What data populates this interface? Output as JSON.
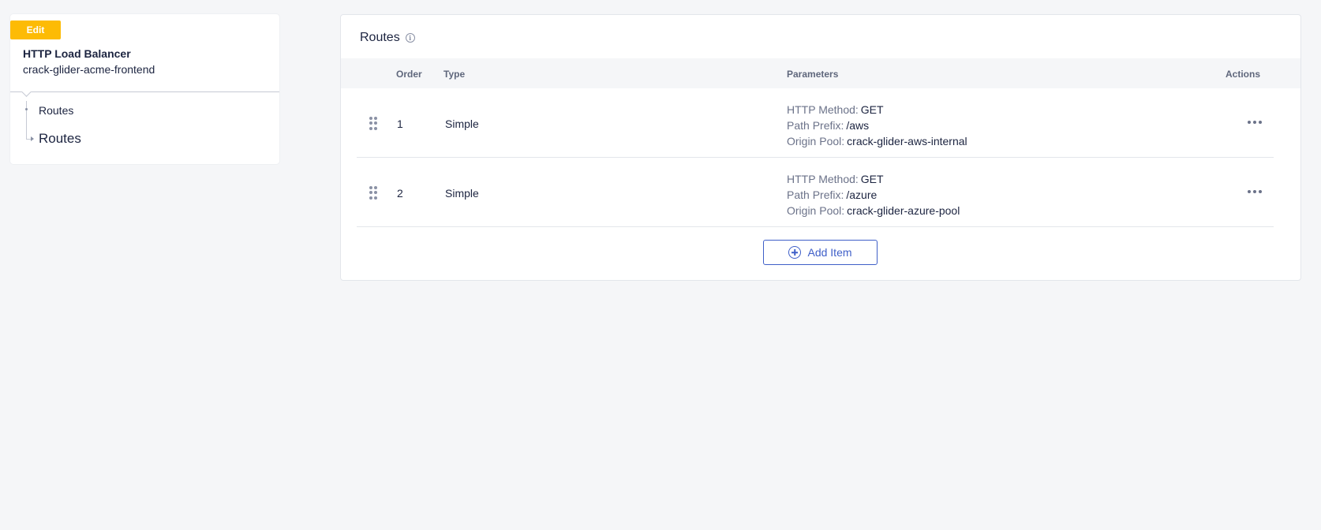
{
  "sidebar": {
    "badge": "Edit",
    "object_type": "HTTP Load Balancer",
    "object_name": "crack-glider-acme-frontend",
    "tree": [
      {
        "label": "Routes"
      },
      {
        "label": "Routes"
      }
    ]
  },
  "routes_card": {
    "title": "Routes",
    "info_icon": "info-icon",
    "columns": {
      "order": "Order",
      "type": "Type",
      "parameters": "Parameters",
      "actions": "Actions"
    },
    "rows": [
      {
        "order": "1",
        "type": "Simple",
        "params": [
          {
            "key": "HTTP Method:",
            "value": "GET"
          },
          {
            "key": "Path Prefix:",
            "value": "/aws"
          },
          {
            "key": "Origin Pool:",
            "value": "crack-glider-aws-internal"
          }
        ]
      },
      {
        "order": "2",
        "type": "Simple",
        "params": [
          {
            "key": "HTTP Method:",
            "value": "GET"
          },
          {
            "key": "Path Prefix:",
            "value": "/azure"
          },
          {
            "key": "Origin Pool:",
            "value": "crack-glider-azure-pool"
          }
        ]
      }
    ],
    "add_button": "Add Item"
  },
  "colors": {
    "badge": "#fdbb05",
    "accent": "#3f5fc8",
    "page_bg": "#f5f6f8"
  }
}
